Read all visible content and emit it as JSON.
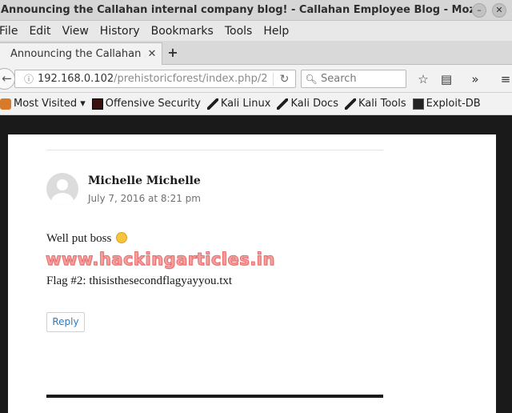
{
  "window": {
    "title": "Announcing the Callahan internal company blog! - Callahan Employee Blog - Mozilla Firefox",
    "minimize_glyph": "–",
    "close_glyph": "✕"
  },
  "menu": {
    "items": [
      {
        "label": "File"
      },
      {
        "label": "Edit"
      },
      {
        "label": "View"
      },
      {
        "label": "History"
      },
      {
        "label": "Bookmarks"
      },
      {
        "label": "Tools"
      },
      {
        "label": "Help"
      }
    ]
  },
  "tabs": {
    "active_title": "Announcing the Callahan ...",
    "close_glyph": "✕",
    "new_tab_glyph": "+"
  },
  "navbar": {
    "url_host": "192.168.0.102",
    "url_path": "/prehistoricforest/index.php/2",
    "search_placeholder": "Search",
    "icons": [
      "back-arrow-icon",
      "info-icon",
      "reload-icon",
      "search-icon",
      "star-icon",
      "reading-list-icon",
      "overflow-chevron-icon",
      "hamburger-menu-icon"
    ]
  },
  "bookmarks": {
    "items": [
      {
        "label": "Most Visited ▾",
        "icon": "gear-icon"
      },
      {
        "label": "Offensive Security",
        "icon": "offsec-icon"
      },
      {
        "label": "Kali Linux",
        "icon": "kali-dragon-icon"
      },
      {
        "label": "Kali Docs",
        "icon": "kali-dragon-icon"
      },
      {
        "label": "Kali Tools",
        "icon": "kali-dragon-icon"
      },
      {
        "label": "Exploit-DB",
        "icon": "exploit-db-icon"
      }
    ]
  },
  "comment": {
    "author": "Michelle Michelle",
    "date": "July 7, 2016 at 8:21 pm",
    "text": "Well put boss",
    "watermark": "www.hackingarticles.in",
    "flag_line": "Flag #2: thisisthesecondflagyayyou.txt",
    "reply_label": "Reply"
  }
}
